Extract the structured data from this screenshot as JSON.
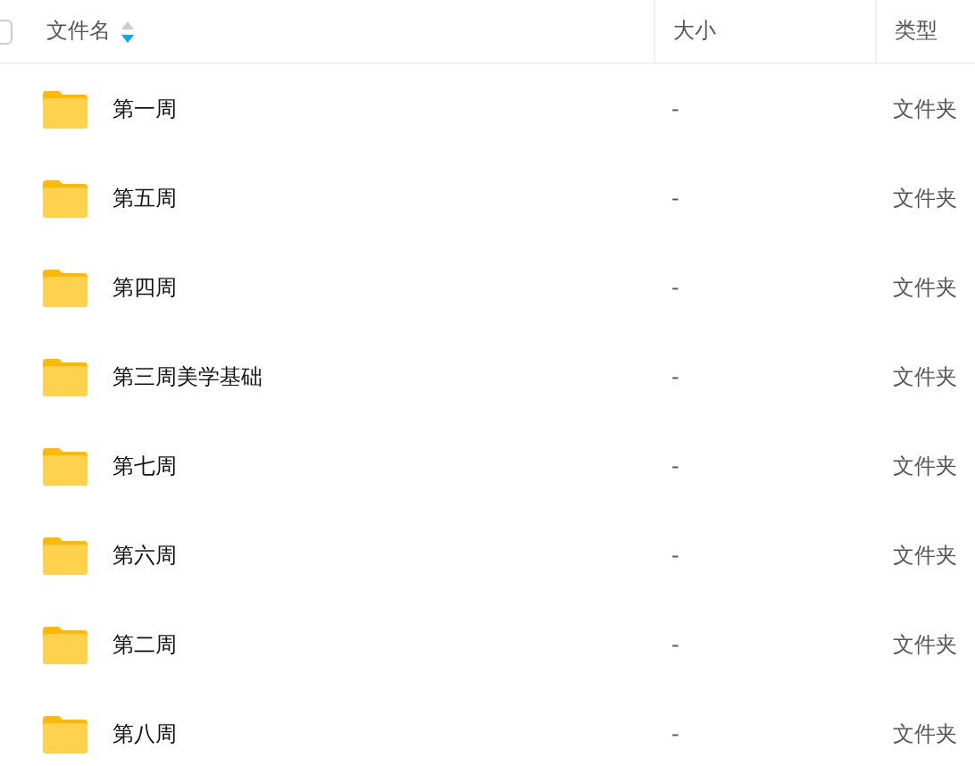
{
  "table": {
    "select_all": {
      "checked": false
    },
    "columns": [
      {
        "label": "文件名",
        "sorted": true
      },
      {
        "label": "大小",
        "sorted": false
      },
      {
        "label": "类型",
        "sorted": false
      }
    ],
    "rows": [
      {
        "name": "第一周",
        "size": "-",
        "type": "文件夹"
      },
      {
        "name": "第五周",
        "size": "-",
        "type": "文件夹"
      },
      {
        "name": "第四周",
        "size": "-",
        "type": "文件夹"
      },
      {
        "name": "第三周美学基础",
        "size": "-",
        "type": "文件夹"
      },
      {
        "name": "第七周",
        "size": "-",
        "type": "文件夹"
      },
      {
        "name": "第六周",
        "size": "-",
        "type": "文件夹"
      },
      {
        "name": "第二周",
        "size": "-",
        "type": "文件夹"
      },
      {
        "name": "第八周",
        "size": "-",
        "type": "文件夹"
      }
    ]
  }
}
